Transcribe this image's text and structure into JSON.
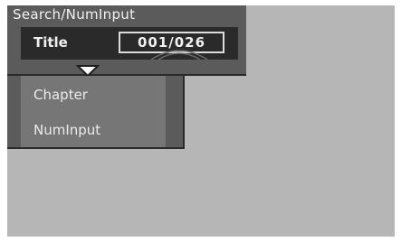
{
  "menu": {
    "title": "Search/NumInput",
    "title_row": {
      "label": "Title",
      "value": "001/026"
    },
    "items": [
      {
        "label": "Chapter"
      },
      {
        "label": "NumInput"
      }
    ]
  },
  "colors": {
    "screen_bg": "#b6b6b6",
    "panel": "#5b5b5b",
    "row_dark": "#2a2a2a",
    "submenu_face": "#767676",
    "text": "#f0f0f0"
  },
  "icons": {
    "expand": "triangle-down-icon",
    "decoration": "arc-decoration"
  }
}
